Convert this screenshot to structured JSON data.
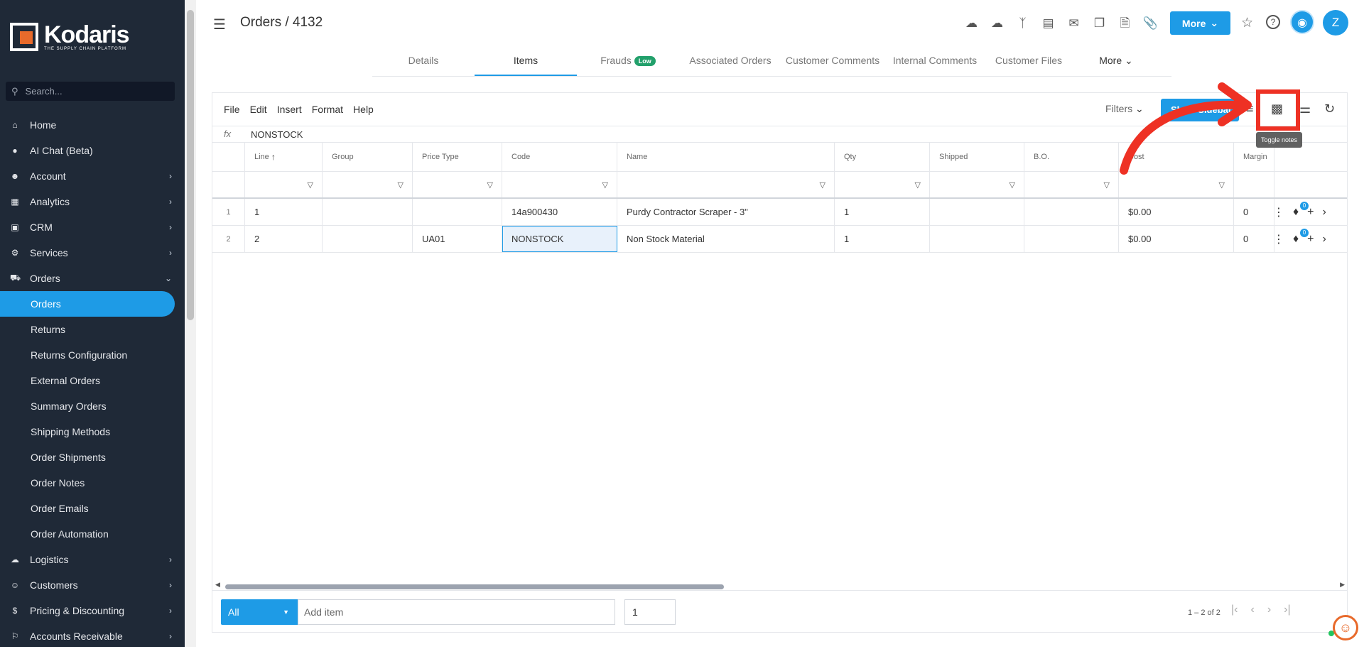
{
  "sidebar": {
    "brand": "Kodaris",
    "tagline": "THE SUPPLY CHAIN PLATFORM",
    "search_placeholder": "Search...",
    "items": [
      {
        "label": "Home",
        "icon": "home-icon"
      },
      {
        "label": "AI Chat (Beta)",
        "icon": "robot-icon"
      },
      {
        "label": "Account",
        "icon": "person-icon"
      },
      {
        "label": "Analytics",
        "icon": "chart-icon"
      },
      {
        "label": "CRM",
        "icon": "contact-card-icon"
      },
      {
        "label": "Services",
        "icon": "services-icon"
      },
      {
        "label": "Orders",
        "icon": "truck-icon"
      }
    ],
    "orders_sub": [
      "Orders",
      "Returns",
      "Returns Configuration",
      "External Orders",
      "Summary Orders",
      "Shipping Methods",
      "Order Shipments",
      "Order Notes",
      "Order Emails",
      "Order Automation"
    ],
    "bottom_items": [
      {
        "label": "Logistics",
        "icon": "logistics-icon"
      },
      {
        "label": "Customers",
        "icon": "people-icon"
      },
      {
        "label": "Pricing & Discounting",
        "icon": "dollar-icon"
      },
      {
        "label": "Accounts Receivable",
        "icon": "bank-icon"
      }
    ]
  },
  "header": {
    "breadcrumb": "Orders / 4132",
    "more_label": "More",
    "avatar_initial": "Z"
  },
  "tabs": [
    {
      "label": "Details"
    },
    {
      "label": "Items"
    },
    {
      "label": "Frauds",
      "badge": "Low"
    },
    {
      "label": "Associated Orders"
    },
    {
      "label": "Customer Comments"
    },
    {
      "label": "Internal Comments"
    },
    {
      "label": "Customer Files"
    },
    {
      "label": "More"
    }
  ],
  "editor": {
    "menu": [
      "File",
      "Edit",
      "Insert",
      "Format",
      "Help"
    ],
    "filters_label": "Filters",
    "show_button": "Show Sidebar",
    "tooltip": "Toggle notes",
    "fx_label": "fx",
    "fx_value": "NONSTOCK"
  },
  "table": {
    "columns": [
      "Line",
      "Group",
      "Price Type",
      "Code",
      "Name",
      "Qty",
      "Shipped",
      "B.O.",
      "Cost",
      "Margin"
    ],
    "rows": [
      {
        "num": "1",
        "line": "1",
        "group": "",
        "price_type": "",
        "code": "14a900430",
        "name": "Purdy Contractor Scraper - 3\"",
        "qty": "1",
        "shipped": "",
        "bo": "",
        "cost": "$0.00",
        "margin": "0",
        "tag_count": "0"
      },
      {
        "num": "2",
        "line": "2",
        "group": "",
        "price_type": "UA01",
        "code": "NONSTOCK",
        "name": "Non Stock Material",
        "qty": "1",
        "shipped": "",
        "bo": "",
        "cost": "$0.00",
        "margin": "0",
        "tag_count": "0"
      }
    ]
  },
  "footer": {
    "scope": "All",
    "add_placeholder": "Add item",
    "qty": "1",
    "range": "1 – 2 of 2"
  },
  "colors": {
    "accent": "#1e9be6",
    "sidebar": "#1f2937",
    "annotation": "#ee3124",
    "brand_orange": "#e86a2b"
  }
}
